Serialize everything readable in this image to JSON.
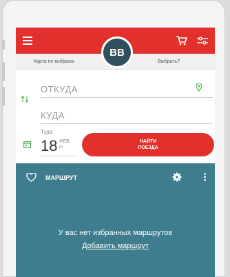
{
  "header": {
    "avatar_initials": "BB",
    "brand_color": "#e2302d",
    "icons": [
      "menu-icon",
      "cart-icon",
      "filter-icon"
    ]
  },
  "subbar": {
    "card_status": "Карта не выбрана",
    "choose_label": "Выбрать?"
  },
  "search": {
    "from_placeholder": "ОТКУДА",
    "to_placeholder": "КУДА",
    "date_caption": "Туда",
    "date_day": "18",
    "date_month": "ФЕВ",
    "date_weekday": "вт",
    "find_line1": "НАЙТИ",
    "find_line2": "ПОЕЗДА"
  },
  "routes": {
    "title": "МАРШРУТ",
    "empty_message": "У вас нет избранных маршрутов",
    "add_link": "Добавить маршрут",
    "panel_color": "#3d7d8d"
  }
}
